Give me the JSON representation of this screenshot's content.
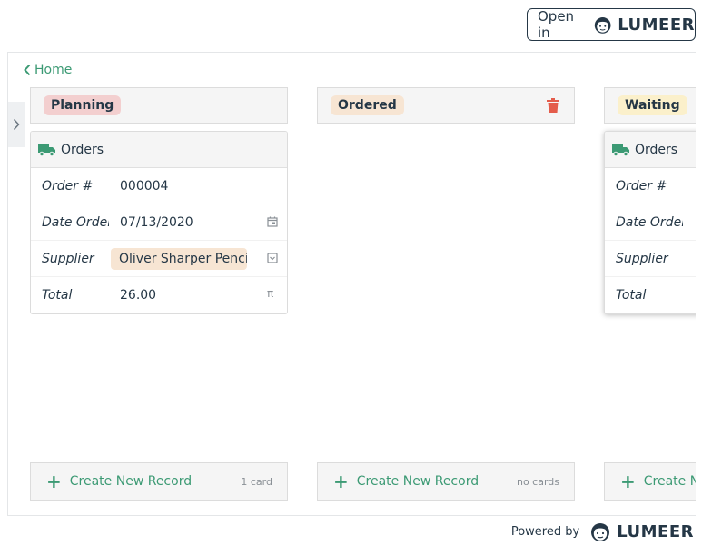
{
  "open_in": {
    "label": "Open in",
    "brand": "LUMEER"
  },
  "nav": {
    "home_label": "Home"
  },
  "columns": [
    {
      "tag": "Planning",
      "tag_color": "#f3cfcf",
      "card": {
        "collection": "Orders",
        "rows": [
          {
            "label": "Order #",
            "value": "000004"
          },
          {
            "label": "Date Ordered",
            "value": "07/13/2020"
          },
          {
            "label": "Supplier",
            "value": "Oliver Sharper Pencil"
          },
          {
            "label": "Total",
            "value": "26.00"
          }
        ]
      },
      "create_label": "Create New Record",
      "count": "1 card"
    },
    {
      "tag": "Ordered",
      "tag_color": "#f7e5d3",
      "create_label": "Create New Record",
      "count": "no cards"
    },
    {
      "tag": "Waiting",
      "tag_color": "#fbf0cb",
      "card": {
        "collection": "Orders",
        "rows": [
          {
            "label": "Order #",
            "value": ""
          },
          {
            "label": "Date Ordered",
            "value": ""
          },
          {
            "label": "Supplier",
            "value": ""
          },
          {
            "label": "Total",
            "value": ""
          }
        ]
      },
      "create_label": "Create Ne"
    }
  ],
  "footer": {
    "powered_by": "Powered by",
    "brand": "LUMEER"
  },
  "colors": {
    "accent_green": "#3c9a74",
    "delete_red": "#e45c4b",
    "dark_text": "#253746"
  }
}
